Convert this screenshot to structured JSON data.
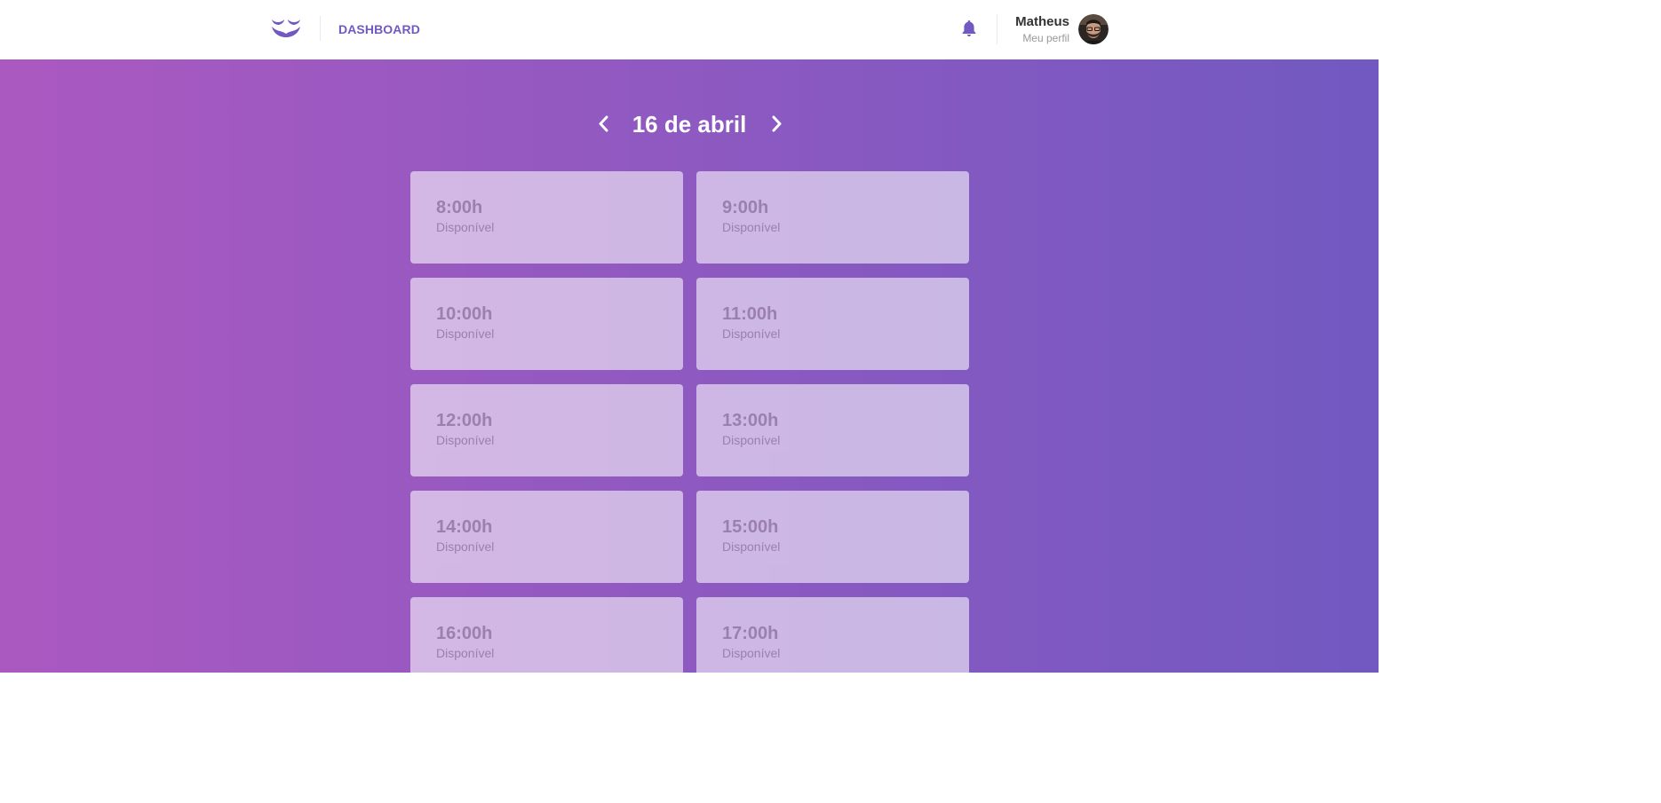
{
  "header": {
    "logo_icon": "mustache-logo-icon",
    "nav_link": "DASHBOARD",
    "notification_icon": "bell-icon",
    "profile": {
      "name": "Matheus",
      "link": "Meu perfil",
      "avatar_icon": "user-avatar"
    }
  },
  "schedule": {
    "date_title": "16 de abril",
    "prev_icon": "chevron-left-icon",
    "next_icon": "chevron-right-icon",
    "slots": [
      {
        "time": "8:00h",
        "status": "Disponível"
      },
      {
        "time": "9:00h",
        "status": "Disponível"
      },
      {
        "time": "10:00h",
        "status": "Disponível"
      },
      {
        "time": "11:00h",
        "status": "Disponível"
      },
      {
        "time": "12:00h",
        "status": "Disponível"
      },
      {
        "time": "13:00h",
        "status": "Disponível"
      },
      {
        "time": "14:00h",
        "status": "Disponível"
      },
      {
        "time": "15:00h",
        "status": "Disponível"
      },
      {
        "time": "16:00h",
        "status": "Disponível"
      },
      {
        "time": "17:00h",
        "status": "Disponível"
      }
    ]
  },
  "colors": {
    "accent": "#7159c1",
    "gradient_start": "#ab59c1",
    "gradient_end": "#7159c1"
  }
}
